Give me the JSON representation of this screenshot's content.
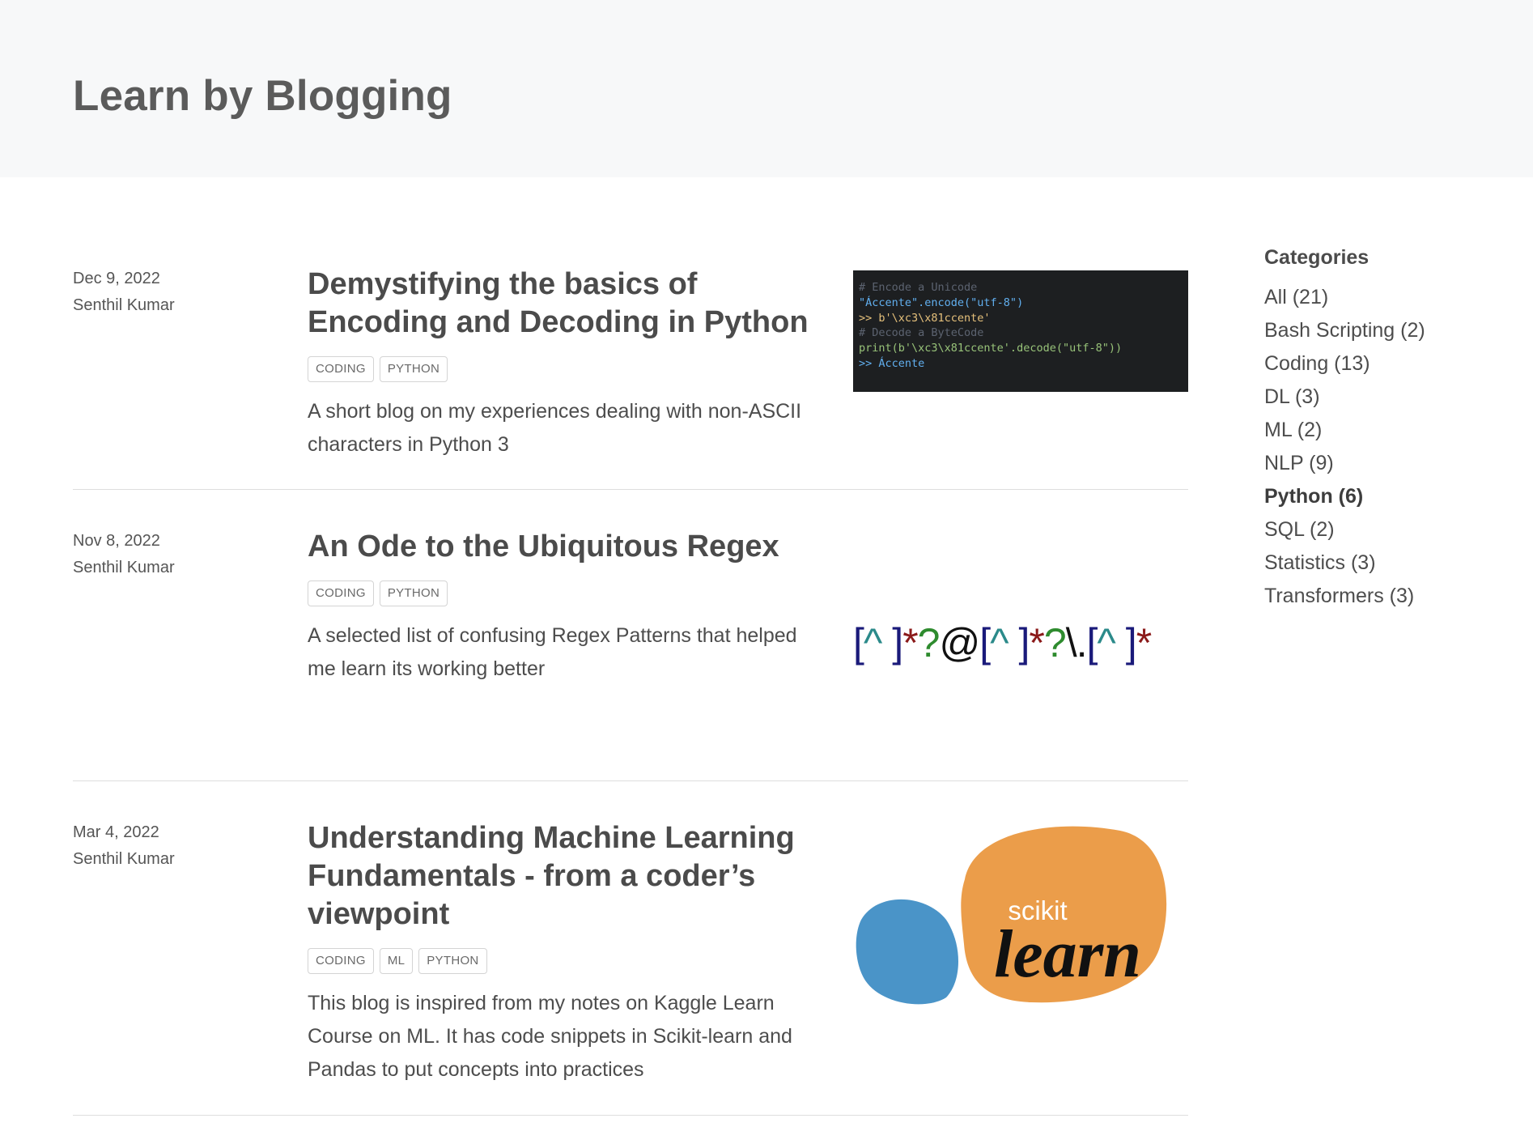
{
  "site": {
    "title": "Learn by Blogging"
  },
  "posts": [
    {
      "date": "Dec 9, 2022",
      "author": "Senthil Kumar",
      "title": "Demystifying the basics of Encoding and Decoding in Python",
      "tags": [
        "CODING",
        "PYTHON"
      ],
      "description": "A short blog on my experiences dealing with non-ASCII characters in Python 3",
      "thumbnail": {
        "kind": "code",
        "lines": [
          "# Encode a Unicode",
          "\"Áccente\".encode(\"utf-8\")",
          ">> b'\\xc3\\x81ccente'",
          "# Decode a ByteCode",
          "print(b'\\xc3\\x81ccente'.decode(\"utf-8\"))",
          ">> Áccente"
        ]
      }
    },
    {
      "date": "Nov 8, 2022",
      "author": "Senthil Kumar",
      "title": "An Ode to the Ubiquitous Regex",
      "tags": [
        "CODING",
        "PYTHON"
      ],
      "description": "A selected list of confusing Regex Patterns that helped me learn its working better",
      "thumbnail": {
        "kind": "regex",
        "text": "[^ ]*?@[^ ]*?\\.[^ ]*"
      }
    },
    {
      "date": "Mar 4, 2022",
      "author": "Senthil Kumar",
      "title": "Understanding Machine Learning Fundamentals - from a coder’s viewpoint",
      "tags": [
        "CODING",
        "ML",
        "PYTHON"
      ],
      "description": "This blog is inspired from my notes on Kaggle Learn Course on ML. It has code snippets in Scikit-learn and Pandas to put concepts into practices",
      "thumbnail": {
        "kind": "logo",
        "logo_small": "scikit",
        "logo_big": "learn"
      }
    }
  ],
  "sidebar": {
    "title": "Categories",
    "categories": [
      {
        "label": "All (21)",
        "active": false
      },
      {
        "label": "Bash Scripting (2)",
        "active": false
      },
      {
        "label": "Coding (13)",
        "active": false
      },
      {
        "label": "DL (3)",
        "active": false
      },
      {
        "label": "ML (2)",
        "active": false
      },
      {
        "label": "NLP (9)",
        "active": false
      },
      {
        "label": "Python (6)",
        "active": true
      },
      {
        "label": "SQL (2)",
        "active": false
      },
      {
        "label": "Statistics (3)",
        "active": false
      },
      {
        "label": "Transformers (3)",
        "active": false
      }
    ]
  },
  "colors": {
    "banner": "#f7f8f9",
    "text": "#4b4b4b",
    "sklearn_orange": "#eb9d4a",
    "sklearn_blue": "#4a94c8"
  }
}
